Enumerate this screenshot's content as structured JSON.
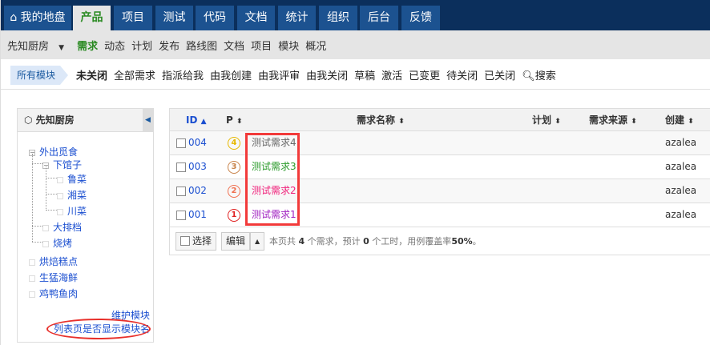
{
  "topnav": {
    "tabs": [
      {
        "label": "我的地盘",
        "icon": "home-icon"
      },
      {
        "label": "产品",
        "active": true
      },
      {
        "label": "项目"
      },
      {
        "label": "测试"
      },
      {
        "label": "代码"
      },
      {
        "label": "文档"
      },
      {
        "label": "统计"
      },
      {
        "label": "组织"
      },
      {
        "label": "后台"
      },
      {
        "label": "反馈"
      }
    ]
  },
  "subnav": {
    "product": "先知厨房",
    "items": [
      "需求",
      "动态",
      "计划",
      "发布",
      "路线图",
      "文档",
      "项目",
      "模块",
      "概况"
    ]
  },
  "filter": {
    "crumb": "所有模块",
    "items": [
      "未关闭",
      "全部需求",
      "指派给我",
      "由我创建",
      "由我评审",
      "由我关闭",
      "草稿",
      "激活",
      "已变更",
      "待关闭",
      "已关闭"
    ],
    "search": "搜索"
  },
  "sidebar": {
    "title": "先知厨房",
    "tree": [
      "外出觅食",
      "下馆子",
      "鲁菜",
      "湘菜",
      "川菜",
      "大排档",
      "烧烤",
      "烘焙糕点",
      "生猛海鲜",
      "鸡鸭鱼肉"
    ],
    "maintain": "维护模块",
    "show_module": "列表页是否显示模块名"
  },
  "table": {
    "headers": {
      "id": "ID",
      "p": "P",
      "name": "需求名称",
      "plan": "计划",
      "source": "需求来源",
      "creator": "创建"
    },
    "rows": [
      {
        "id": "004",
        "pri": "4",
        "name": "测试需求4",
        "creator": "azalea",
        "pcolor": "#e6b800",
        "ncolor": "#666666"
      },
      {
        "id": "003",
        "pri": "3",
        "name": "测试需求3",
        "creator": "azalea",
        "pcolor": "#c8834a",
        "ncolor": "#2a9a2a"
      },
      {
        "id": "002",
        "pri": "2",
        "name": "测试需求2",
        "creator": "azalea",
        "pcolor": "#f07050",
        "ncolor": "#f0207a"
      },
      {
        "id": "001",
        "pri": "1",
        "name": "测试需求1",
        "creator": "azalea",
        "pcolor": "#e02020",
        "ncolor": "#a020c0"
      }
    ],
    "footer": {
      "select": "选择",
      "edit": "编辑",
      "summary_a": "本页共 ",
      "count": "4",
      "summary_b": " 个需求，预计 ",
      "hours": "0",
      "summary_c": " 个工时，用例覆盖率",
      "coverage": "50%",
      "summary_d": "。"
    }
  }
}
